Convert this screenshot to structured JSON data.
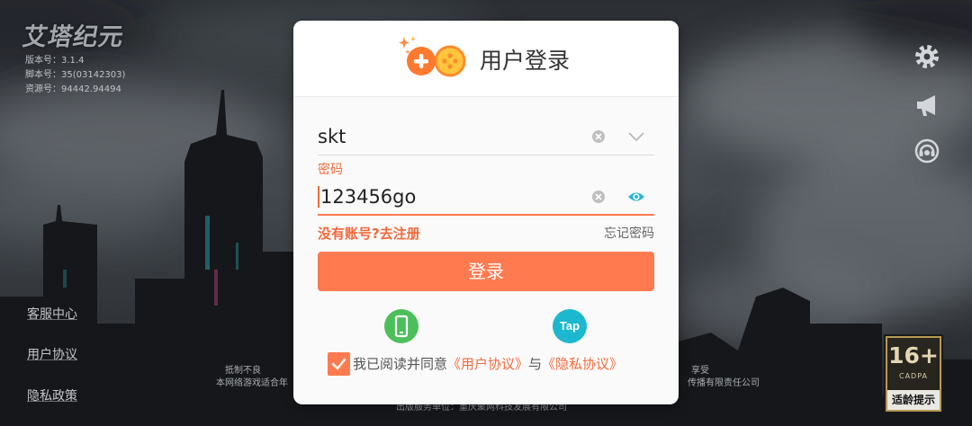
{
  "game": {
    "logo_text": "艾塔纪元",
    "version": "版本号：3.1.4",
    "script": "脚本号：35(03142303)",
    "resource": "资源号：94442.94494"
  },
  "side_links": [
    {
      "label": "客服中心"
    },
    {
      "label": "用户协议"
    },
    {
      "label": "隐私政策"
    }
  ],
  "toolbar_icons": [
    "settings-icon",
    "announcement-icon",
    "customer-service-icon"
  ],
  "health_notice": {
    "line1_left": "抵制不良",
    "line1_right": "享受",
    "line2_left": "本网络游戏适合年",
    "line2_right": "传播有限责任公司",
    "publisher": "出版服务单位：重庆聚网科技发展有限公司"
  },
  "age_rating": {
    "rating": "16+",
    "org": "CADPA",
    "label": "适龄提示"
  },
  "login": {
    "title": "用户登录",
    "username": {
      "value": "skt"
    },
    "password": {
      "label": "密码",
      "value": "123456go"
    },
    "register_link": "没有账号?去注册",
    "forgot_link": "忘记密码",
    "submit_label": "登录",
    "alt_logins": [
      {
        "icon": "phone-login-icon"
      },
      {
        "icon": "taptap-login-icon",
        "label": "Tap"
      }
    ],
    "agreement": {
      "checked": true,
      "prefix": "我已阅读并同意",
      "user_agreement": "《用户协议》",
      "conjunction": "与",
      "privacy_agreement": "《隐私协议》"
    }
  },
  "colors": {
    "accent": "#ff7a4f",
    "accent_text": "#f26a3b",
    "phone_green": "#4cbf5a",
    "tap_teal": "#1cb8cf",
    "eye_icon": "#2ab4d8"
  }
}
